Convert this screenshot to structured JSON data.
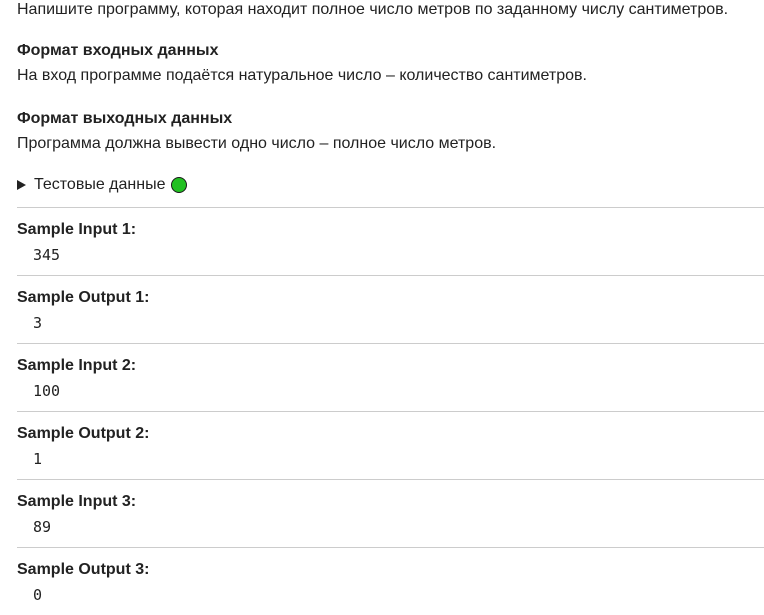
{
  "problem": {
    "intro": "Напишите программу, которая находит полное число метров по заданному числу сантиметров.",
    "input_heading": "Формат входных данных",
    "input_text": "На вход программе подаётся натуральное число – количество сантиметров.",
    "output_heading": "Формат выходных данных",
    "output_text": "Программа должна вывести одно число – полное число метров."
  },
  "test_data": {
    "label": "Тестовые данные",
    "status_color": "#22c022",
    "status_icon": "green-circle-icon"
  },
  "samples": [
    {
      "label": "Sample Input 1:",
      "value": "345"
    },
    {
      "label": "Sample Output 1:",
      "value": "3"
    },
    {
      "label": "Sample Input 2:",
      "value": "100"
    },
    {
      "label": "Sample Output 2:",
      "value": "1"
    },
    {
      "label": "Sample Input 3:",
      "value": "89"
    },
    {
      "label": "Sample Output 3:",
      "value": "0"
    }
  ]
}
